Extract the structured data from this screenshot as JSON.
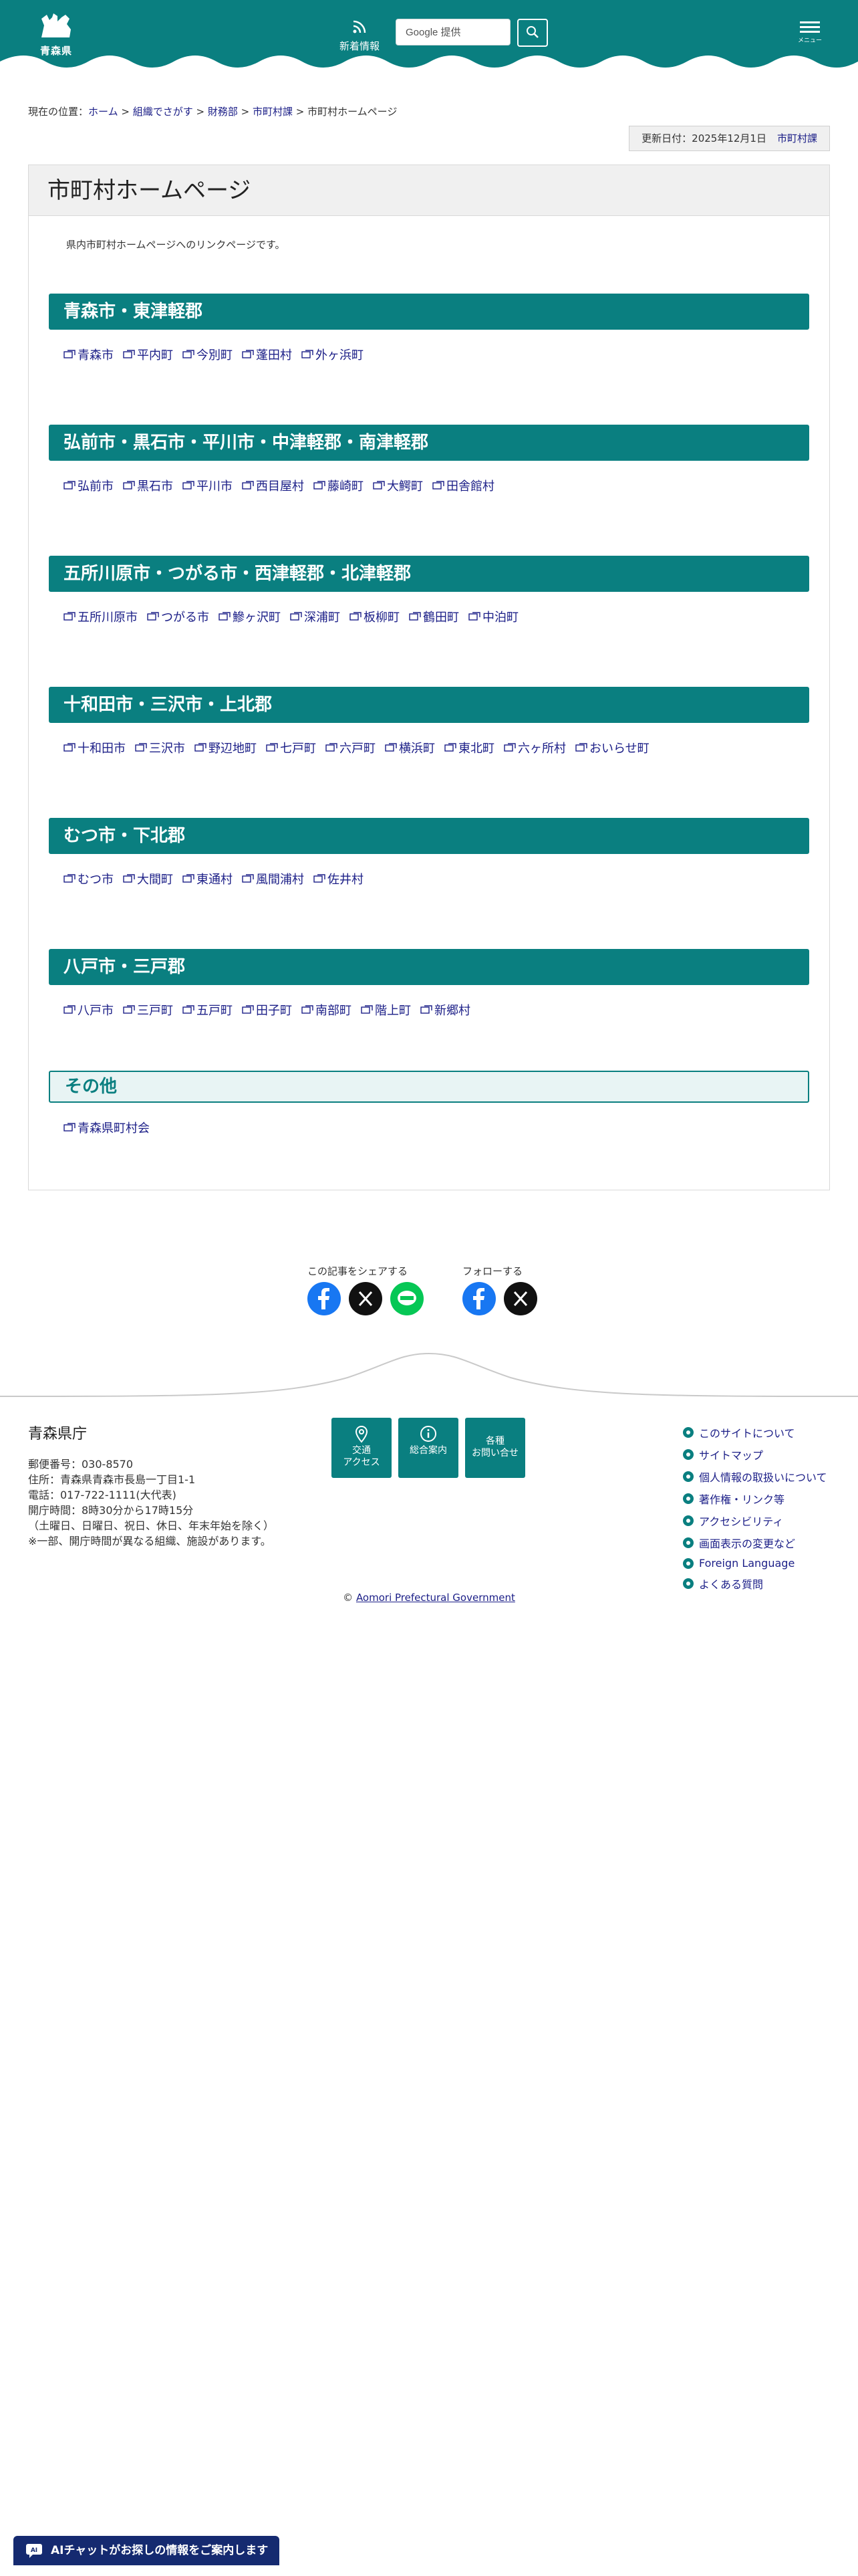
{
  "header": {
    "logo_text": "青森県",
    "news_label": "新着情報",
    "search_placeholder": "Google 提供",
    "menu_label": "メニュー"
  },
  "breadcrumb": {
    "prefix": "現在の位置：",
    "items": [
      "ホーム",
      "組織でさがす",
      "財務部",
      "市町村課"
    ],
    "current": "市町村ホームページ",
    "separator": " > "
  },
  "updated": {
    "label": "更新日付：2025年12月1日",
    "dept": "市町村課"
  },
  "page": {
    "title": "市町村ホームページ",
    "intro": "県内市町村ホームページへのリンクページです。"
  },
  "sections": [
    {
      "heading": "青森市・東津軽郡",
      "links": [
        "青森市",
        "平内町",
        "今別町",
        "蓬田村",
        "外ヶ浜町"
      ]
    },
    {
      "heading": "弘前市・黒石市・平川市・中津軽郡・南津軽郡",
      "links": [
        "弘前市",
        "黒石市",
        "平川市",
        "西目屋村",
        "藤崎町",
        "大鰐町",
        "田舎館村"
      ]
    },
    {
      "heading": "五所川原市・つがる市・西津軽郡・北津軽郡",
      "links": [
        "五所川原市",
        "つがる市",
        "鰺ヶ沢町",
        "深浦町",
        "板柳町",
        "鶴田町",
        "中泊町"
      ]
    },
    {
      "heading": "十和田市・三沢市・上北郡",
      "links": [
        "十和田市",
        "三沢市",
        "野辺地町",
        "七戸町",
        "六戸町",
        "横浜町",
        "東北町",
        "六ヶ所村",
        "おいらせ町"
      ]
    },
    {
      "heading": "むつ市・下北郡",
      "links": [
        "むつ市",
        "大間町",
        "東通村",
        "風間浦村",
        "佐井村"
      ]
    },
    {
      "heading": "八戸市・三戸郡",
      "links": [
        "八戸市",
        "三戸町",
        "五戸町",
        "田子町",
        "南部町",
        "階上町",
        "新郷村"
      ]
    },
    {
      "heading": "その他",
      "links": [
        "青森県町村会"
      ]
    }
  ],
  "share": {
    "share_label": "この記事をシェアする",
    "follow_label": "フォローする"
  },
  "footer": {
    "org": "青森県庁",
    "info": [
      "郵便番号：030-8570",
      "住所：青森県青森市長島一丁目1-1",
      "電話：017-722-1111(大代表)",
      "開庁時間：8時30分から17時15分",
      "（土曜日、日曜日、祝日、休日、年末年始を除く）",
      "※一部、開庁時間が異なる組織、施設があります。"
    ],
    "btn_access": [
      "交通",
      "アクセス"
    ],
    "btn_guide": "総合案内",
    "btn_contact": [
      "各種",
      "お問い合せ"
    ],
    "links": [
      "このサイトについて",
      "サイトマップ",
      "個人情報の取扱いについて",
      "著作権・リンク等",
      "アクセシビリティ",
      "画面表示の変更など",
      "Foreign Language",
      "よくある質問"
    ],
    "copyright_symbol": "©",
    "copyright_link": "Aomori Prefectural Government"
  },
  "ai_chat": {
    "label": "AIチャットがお探しの情報をご案内します ▼"
  },
  "colors": {
    "brand_teal": "#0a7f80",
    "link_navy": "#1d2088",
    "chat_navy": "#152a70"
  }
}
